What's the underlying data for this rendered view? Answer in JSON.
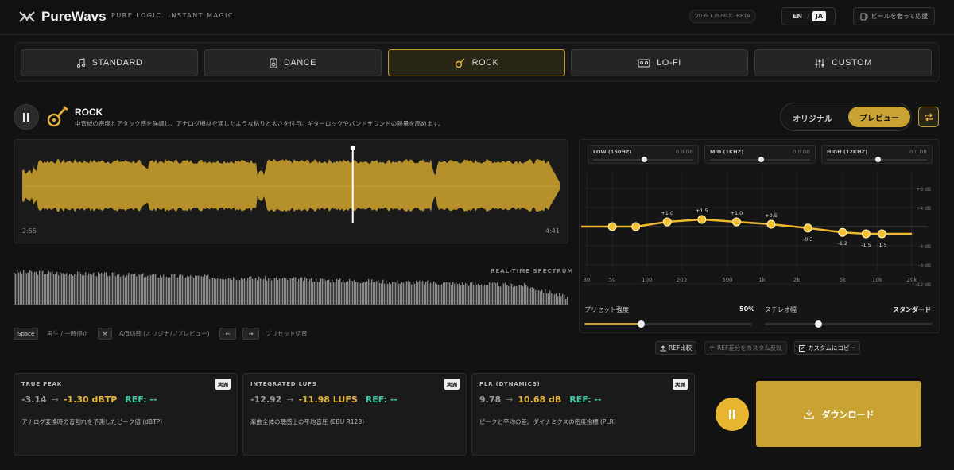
{
  "header": {
    "brand": "PureWavs",
    "tagline": "PURE LOGIC. INSTANT MAGIC.",
    "version": "V0.6.1 PUBLIC BETA",
    "lang_en": "EN",
    "lang_sep": "/",
    "lang_ja": "JA",
    "support": "ビールを奢って応援"
  },
  "presets": [
    {
      "label": "STANDARD",
      "icon": "music-note-icon"
    },
    {
      "label": "DANCE",
      "icon": "speaker-icon"
    },
    {
      "label": "ROCK",
      "icon": "guitar-icon"
    },
    {
      "label": "LO-FI",
      "icon": "cassette-icon"
    },
    {
      "label": "CUSTOM",
      "icon": "sliders-icon"
    }
  ],
  "active_preset": "ROCK",
  "player": {
    "title": "ROCK",
    "description": "中音域の密度とアタック感を強調し、アナログ機材を通したような粘りと太さを付与。ギターロックやバンドサウンドの熱量を高めます。",
    "ab_original": "オリジナル",
    "ab_preview": "プレビュー",
    "time_current": "2:55",
    "time_total": "4:41",
    "playhead_fraction": 0.615,
    "spectrum_label": "REAL-TIME SPECTRUM"
  },
  "shortcuts": [
    {
      "key": "Space",
      "desc": "再生 / 一時停止"
    },
    {
      "key": "M",
      "desc": "A/B切替 (オリジナル/プレビュー)"
    },
    {
      "key": "←",
      "desc": ""
    },
    {
      "key": "→",
      "desc": "プリセット切替"
    }
  ],
  "eq": {
    "bands": [
      {
        "name": "LOW (150HZ)",
        "value": "0.0 DB",
        "level": 0.5
      },
      {
        "name": "MID (1KHZ)",
        "value": "0.0 DB",
        "level": 0.5
      },
      {
        "name": "HIGH (12KHZ)",
        "value": "0.0 DB",
        "level": 0.5
      }
    ],
    "db_ticks": [
      "+8 dB",
      "+4 dB",
      "-4 dB",
      "-8 dB",
      "-12 dB"
    ],
    "freq_ticks": [
      "30",
      "50",
      "100",
      "200",
      "500",
      "1k",
      "2k",
      "5k",
      "10k",
      "20k"
    ],
    "points": [
      {
        "freq": 50,
        "db": 0.0,
        "label": ""
      },
      {
        "freq": 80,
        "db": 0.0,
        "label": ""
      },
      {
        "freq": 150,
        "db": 1.0,
        "label": "+1.0"
      },
      {
        "freq": 300,
        "db": 1.5,
        "label": "+1.5"
      },
      {
        "freq": 600,
        "db": 1.0,
        "label": "+1.0"
      },
      {
        "freq": 1200,
        "db": 0.5,
        "label": "+0.5"
      },
      {
        "freq": 2500,
        "db": -0.3,
        "label": "-0.3"
      },
      {
        "freq": 5000,
        "db": -1.2,
        "label": "-1.2"
      },
      {
        "freq": 8000,
        "db": -1.5,
        "label": "-1.5"
      },
      {
        "freq": 11000,
        "db": -1.5,
        "label": "-1.5"
      }
    ],
    "preset_strength_label": "プリセット強度",
    "preset_strength_value": "50%",
    "preset_strength": 0.5,
    "stereo_label": "ステレオ幅",
    "stereo_value": "スタンダード",
    "stereo_level": 0.5,
    "btn_ref_compare": "REF比較",
    "btn_ref_apply": "REF差分をカスタム反映",
    "btn_copy_custom": "カスタムにコピー"
  },
  "meters": [
    {
      "title": "TRUE PEAK",
      "badge": "実測",
      "orig": "-3.14",
      "arrow": "→",
      "new": "-1.30 dBTP",
      "ref": "REF: --",
      "desc": "アナログ変換時の音割れを予測したピーク値 (dBTP)"
    },
    {
      "title": "INTEGRATED LUFS",
      "badge": "実測",
      "orig": "-12.92",
      "arrow": "→",
      "new": "-11.98 LUFS",
      "ref": "REF: --",
      "desc": "楽曲全体の聴感上の平均音圧 (EBU R128)"
    },
    {
      "title": "PLR (DYNAMICS)",
      "badge": "実測",
      "orig": "9.78",
      "arrow": "→",
      "new": "10.68 dB",
      "ref": "REF: --",
      "desc": "ピークと平均の差。ダイナミクスの密度指標 (PLR)"
    }
  ],
  "download_label": "ダウンロード",
  "colors": {
    "accent": "#c8a233",
    "ref": "#3cc7a1",
    "bg": "#121212"
  }
}
